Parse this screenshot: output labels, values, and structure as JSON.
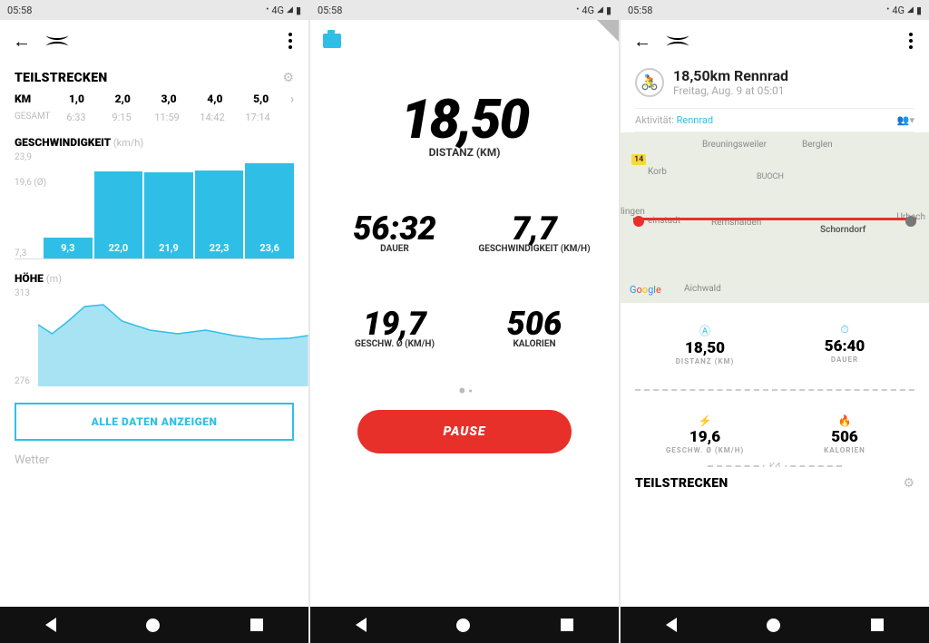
{
  "status": {
    "time": "05:58",
    "net": "4G"
  },
  "screen1": {
    "section_title": "TEILSTRECKEN",
    "km_label": "KM",
    "km": [
      "1,0",
      "2,0",
      "3,0",
      "4,0",
      "5,0"
    ],
    "gesamt_label": "GESAMT",
    "gesamt": [
      "6:33",
      "9:15",
      "11:59",
      "14:42",
      "17:14"
    ],
    "speed_title": "GESCHWINDIGKEIT",
    "speed_unit": "(km/h)",
    "speed_y": [
      "23,9",
      "19,6 (Ø)",
      "7,3"
    ],
    "speed_vals": [
      "9,3",
      "22,0",
      "21,9",
      "22,3",
      "23,6"
    ],
    "elev_title": "HÖHE",
    "elev_unit": "(m)",
    "elev_y": [
      "313",
      "276"
    ],
    "all_btn": "ALLE DATEN ANZEIGEN",
    "wetter": "Wetter"
  },
  "screen2": {
    "big_val": "18,50",
    "big_label": "DISTANZ (KM)",
    "m1_val": "56:32",
    "m1_lbl": "DAUER",
    "m2_val": "7,7",
    "m2_lbl": "GESCHWINDIGKEIT (KM/H)",
    "m3_val": "19,7",
    "m3_lbl": "GESCHW. Ø (KM/H)",
    "m4_val": "506",
    "m4_lbl": "KALORIEN",
    "pause": "PAUSE"
  },
  "screen3": {
    "title": "18,50km Rennrad",
    "subtitle": "Freitag, Aug. 9 at 05:01",
    "activity_label": "Aktivität:",
    "activity_value": "Rennrad",
    "map_places": {
      "breuningsweiler": "Breuningsweiler",
      "berglen": "Berglen",
      "korb": "Korb",
      "buoch": "BUOCH",
      "lingen": "lingen",
      "einstadt": "einstadt",
      "remshalden": "Remshalden",
      "schorndorf": "Schorndorf",
      "urbach": "Urbach",
      "aichwald": "Aichwald",
      "road": "14"
    },
    "s1_v": "18,50",
    "s1_l": "DISTANZ (KM)",
    "s2_v": "56:40",
    "s2_l": "DAUER",
    "s3_v": "19,6",
    "s3_l": "GESCHW. Ø (KM/H)",
    "s4_v": "506",
    "s4_l": "KALORIEN",
    "teilstrecken": "TEILSTRECKEN"
  },
  "chart_data": [
    {
      "type": "bar",
      "title": "GESCHWINDIGKEIT (km/h)",
      "categories": [
        "1,0",
        "2,0",
        "3,0",
        "4,0",
        "5,0"
      ],
      "values": [
        9.3,
        22.0,
        21.9,
        22.3,
        23.6
      ],
      "ylim": [
        7.3,
        23.9
      ],
      "avg": 19.6
    },
    {
      "type": "area",
      "title": "HÖHE (m)",
      "x_range_km": [
        0,
        5
      ],
      "ylim": [
        276,
        313
      ],
      "values": [
        300,
        295,
        301,
        312,
        310,
        298,
        292,
        290,
        293,
        290,
        288,
        289,
        290,
        291,
        289
      ]
    }
  ]
}
